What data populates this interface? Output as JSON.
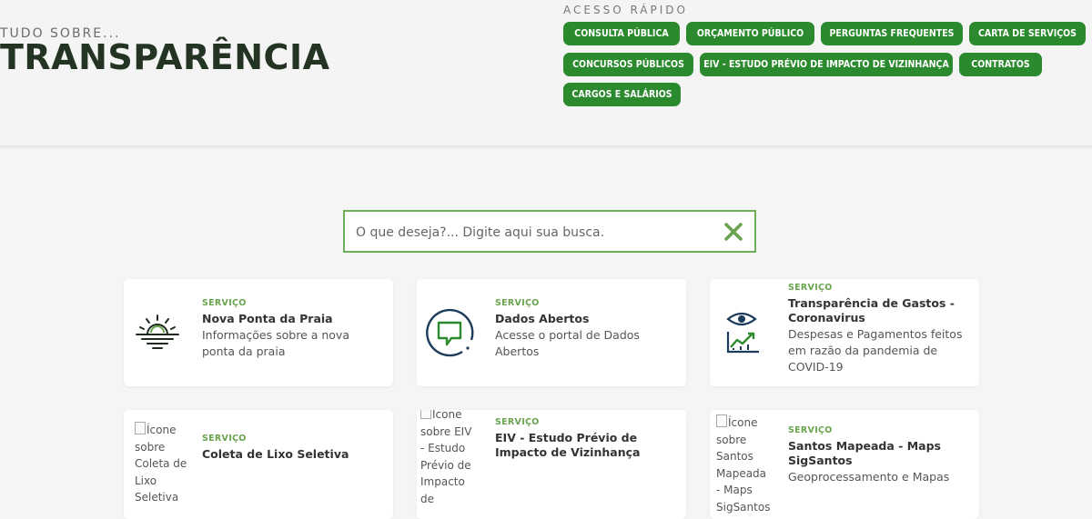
{
  "header": {
    "kicker": "TUDO SOBRE...",
    "title": "TRANSPARÊNCIA"
  },
  "quick_access": {
    "label": "ACESSO RÁPIDO",
    "buttons": [
      "CONSULTA PÚBLICA",
      "ORÇAMENTO PÚBLICO",
      "PERGUNTAS FREQUENTES",
      "CARTA DE SERVIÇOS",
      "CONCURSOS PÚBLICOS",
      "EIV - ESTUDO PRÉVIO DE IMPACTO DE VIZINHANÇA",
      "CONTRATOS",
      "CARGOS E SALÁRIOS"
    ]
  },
  "search": {
    "placeholder": "O que deseja?... Digite aqui sua busca.",
    "value": "",
    "clear_icon": "close-x-icon"
  },
  "cards": [
    {
      "tag": "SERVIÇO",
      "title": "Nova Ponta da Praia",
      "desc": "Informações sobre a nova ponta da praia",
      "icon": "sunset-icon"
    },
    {
      "tag": "SERVIÇO",
      "title": "Dados Abertos",
      "desc": "Acesse o portal de Dados Abertos",
      "icon": "chat-bubble-icon"
    },
    {
      "tag": "SERVIÇO",
      "title": "Transparência de Gastos - Coronavirus",
      "desc": "Despesas e Pagamentos feitos em razão da pandemia de COVID-19",
      "icon": "eye-chart-icon"
    },
    {
      "tag": "SERVIÇO",
      "title": "Coleta de Lixo Seletiva",
      "desc": "",
      "icon_alt": "Ícone sobre Coleta de Lixo Seletiva"
    },
    {
      "tag": "SERVIÇO",
      "title": "EIV - Estudo Prévio de Impacto de Vizinhança",
      "desc": "",
      "icon_alt": "Ícone sobre EIV - Estudo Prévio de Impacto de"
    },
    {
      "tag": "SERVIÇO",
      "title": "Santos Mapeada - Maps SigSantos",
      "desc": "Geoprocessamento e Mapas",
      "icon_alt": "Ícone sobre Santos Mapeada - Maps SigSantos"
    }
  ],
  "colors": {
    "accent_green": "#2c8a2e",
    "tag_green": "#6aa34e",
    "title_dark": "#243423",
    "icon_navy": "#1d3b5a"
  }
}
